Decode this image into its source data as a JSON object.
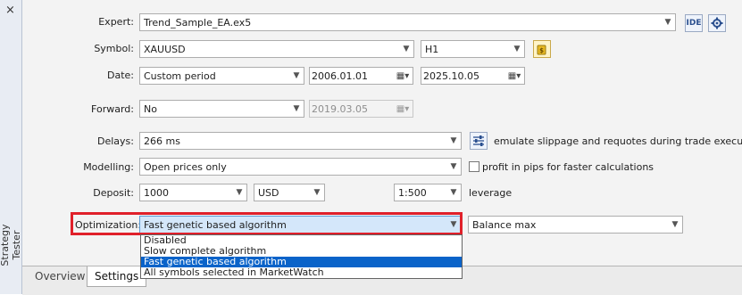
{
  "window": {
    "side_title": "Strategy Tester",
    "close_glyph": "×"
  },
  "expert": {
    "label": "Expert:",
    "value": "Trend_Sample_EA.ex5",
    "ide_label": "IDE"
  },
  "symbol": {
    "label": "Symbol:",
    "value": "XAUUSD",
    "timeframe": "H1"
  },
  "date": {
    "label": "Date:",
    "period": "Custom period",
    "from": "2006.01.01",
    "to": "2025.10.05"
  },
  "forward": {
    "label": "Forward:",
    "value": "No",
    "date": "2019.03.05"
  },
  "delays": {
    "label": "Delays:",
    "value": "266 ms",
    "description": "emulate slippage and requotes during trade execution"
  },
  "modelling": {
    "label": "Modelling:",
    "value": "Open prices only",
    "checkbox_label": "profit in pips for faster calculations"
  },
  "deposit": {
    "label": "Deposit:",
    "amount": "1000",
    "currency": "USD",
    "leverage": "1:500",
    "leverage_label": "leverage"
  },
  "optimization": {
    "label": "Optimization:",
    "value": "Fast genetic based algorithm",
    "criterion": "Balance max",
    "options": [
      "Disabled",
      "Slow complete algorithm",
      "Fast genetic based algorithm",
      "All symbols selected in MarketWatch"
    ],
    "selected_index": 2,
    "highlight_color": "#e0202a"
  },
  "tabs": [
    "Overview",
    "Settings"
  ],
  "active_tab": "Settings",
  "icons": {
    "close": "close-icon",
    "settings": "gear-icon",
    "symbol_props": "symbol-properties-icon",
    "calendar": "calendar-icon",
    "delays": "sliders-icon"
  }
}
